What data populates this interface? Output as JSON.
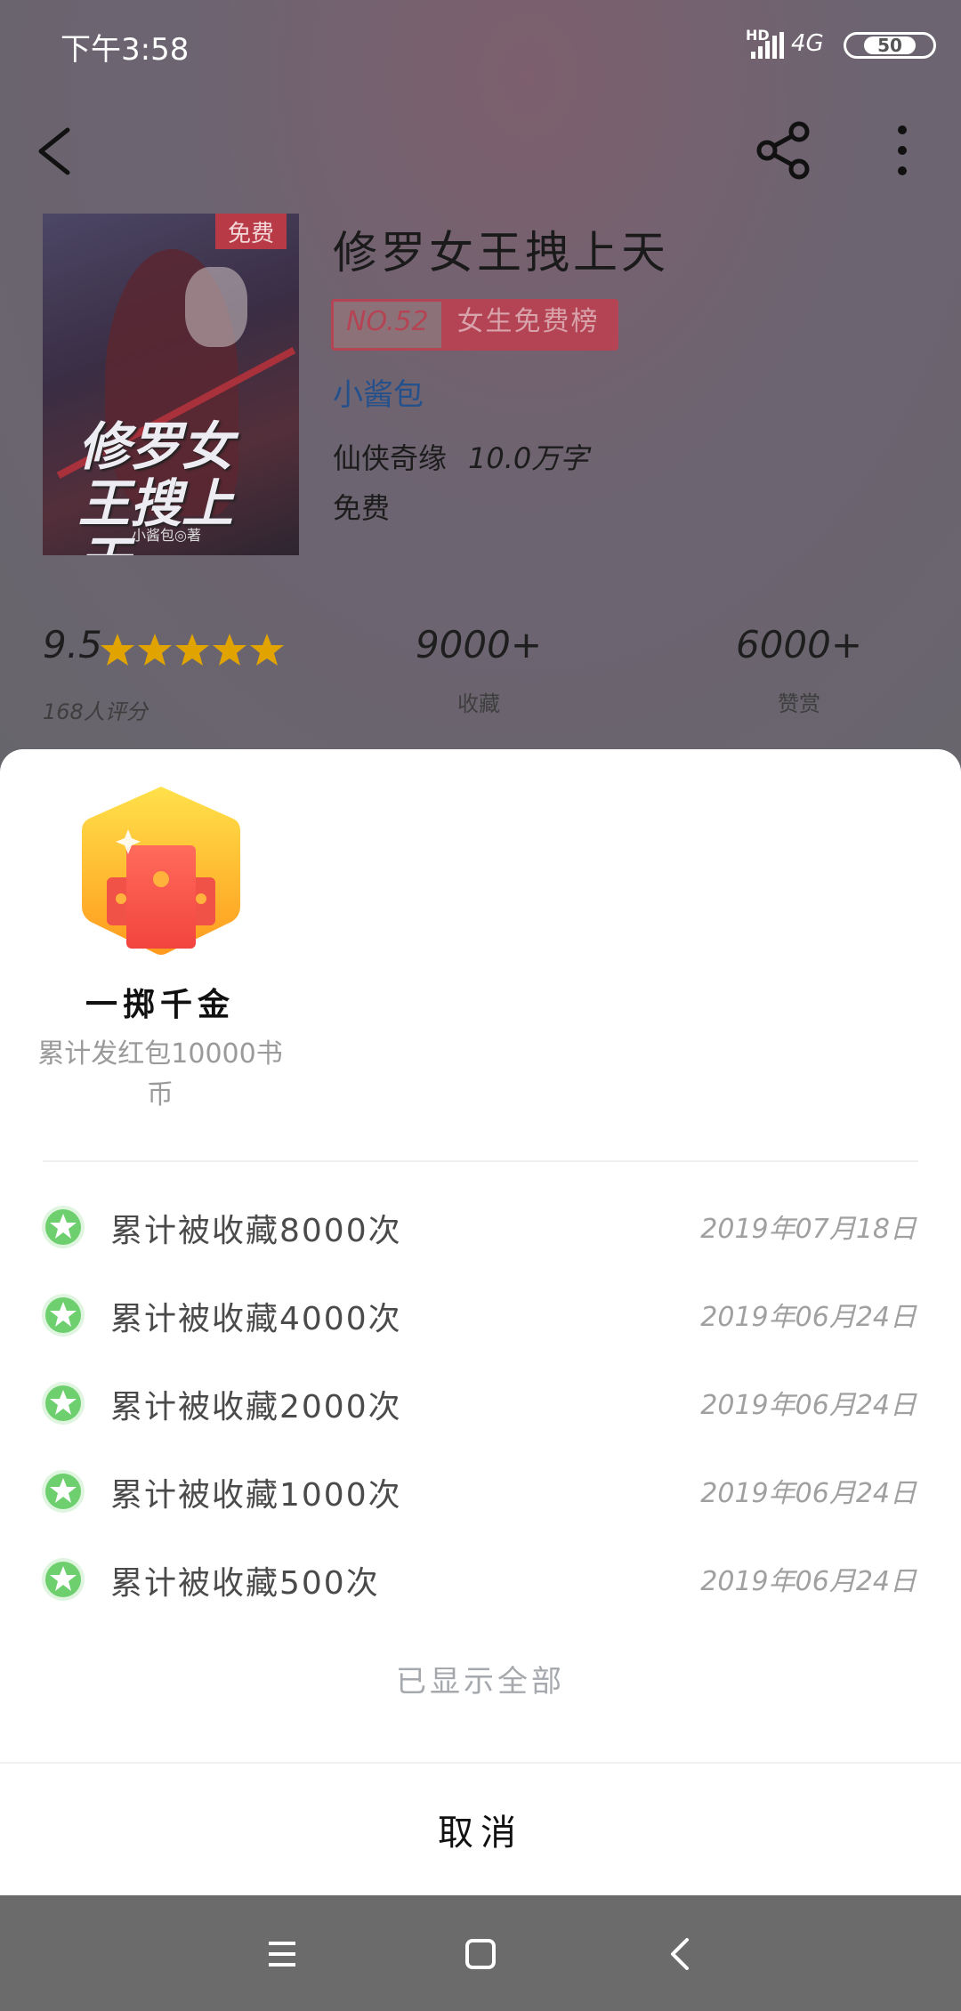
{
  "status_bar": {
    "time": "下午3:58",
    "hd": "HD",
    "network": "4G",
    "battery": "50"
  },
  "top_bar": {
    "back_icon": "back-arrow-icon",
    "share_icon": "share-icon",
    "more_icon": "more-vertical-icon"
  },
  "book": {
    "cover_badge": "免费",
    "cover_title": "修罗女王搜上天",
    "cover_author": "小酱包◎著",
    "title": "修罗女王拽上天",
    "rank_no": "NO.52",
    "rank_list": "女生免费榜",
    "author": "小酱包",
    "genre": "仙侠奇缘",
    "word_count": "10.0万字",
    "price": "免费"
  },
  "stats": {
    "score": "9.5",
    "stars": 5,
    "rating_count": "168人评分",
    "favorites": "9000+",
    "favorites_label": "收藏",
    "rewards": "6000+",
    "rewards_label": "赞赏"
  },
  "sheet": {
    "badge_icon": "red-envelope-badge-icon",
    "badge_title": "一掷千金",
    "badge_desc": "累计发红包10000书币",
    "achievements": [
      {
        "label": "累计被收藏8000次",
        "date": "2019年07月18日"
      },
      {
        "label": "累计被收藏4000次",
        "date": "2019年06月24日"
      },
      {
        "label": "累计被收藏2000次",
        "date": "2019年06月24日"
      },
      {
        "label": "累计被收藏1000次",
        "date": "2019年06月24日"
      },
      {
        "label": "累计被收藏500次",
        "date": "2019年06月24日"
      }
    ],
    "shown_all": "已显示全部",
    "cancel": "取消"
  },
  "colors": {
    "accent_red": "#b44453",
    "star_yellow": "#e0a300",
    "green_star": "#6ecf6e",
    "link_blue": "#24508c"
  }
}
